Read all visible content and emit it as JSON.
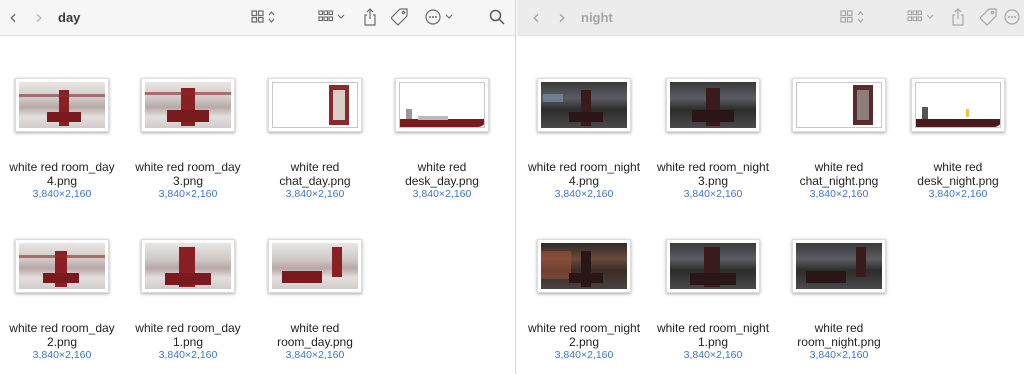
{
  "left_window": {
    "title": "day",
    "items": [
      {
        "name_line1": "white red room_day",
        "name_line2": "4.png",
        "dims": "3,840×2,160"
      },
      {
        "name_line1": "white red room_day",
        "name_line2": "3.png",
        "dims": "3,840×2,160"
      },
      {
        "name_line1": "white red",
        "name_line2": "chat_day.png",
        "dims": "3,840×2,160"
      },
      {
        "name_line1": "white red",
        "name_line2": "desk_day.png",
        "dims": "3,840×2,160"
      },
      {
        "name_line1": "white red room_day",
        "name_line2": "2.png",
        "dims": "3,840×2,160"
      },
      {
        "name_line1": "white red room_day",
        "name_line2": "1.png",
        "dims": "3,840×2,160"
      },
      {
        "name_line1": "white red",
        "name_line2": "room_day.png",
        "dims": "3,840×2,160"
      }
    ]
  },
  "right_window": {
    "title": "night",
    "items": [
      {
        "name_line1": "white red room_night",
        "name_line2": "4.png",
        "dims": "3,840×2,160"
      },
      {
        "name_line1": "white red room_night",
        "name_line2": "3.png",
        "dims": "3,840×2,160"
      },
      {
        "name_line1": "white red",
        "name_line2": "chat_night.png",
        "dims": "3,840×2,160"
      },
      {
        "name_line1": "white red",
        "name_line2": "desk_night.png",
        "dims": "3,840×2,160"
      },
      {
        "name_line1": "white red room_night",
        "name_line2": "2.png",
        "dims": "3,840×2,160"
      },
      {
        "name_line1": "white red room_night",
        "name_line2": "1.png",
        "dims": "3,840×2,160"
      },
      {
        "name_line1": "white red",
        "name_line2": "room_night.png",
        "dims": "3,840×2,160"
      }
    ]
  },
  "toolbar_icons": [
    "back-icon",
    "forward-icon",
    "icon-view-grid-icon",
    "group-by-icon",
    "share-icon",
    "tag-icon",
    "more-actions-icon",
    "search-icon"
  ],
  "colors": {
    "dims_text": "#3d74c8",
    "accent_red": "#8a1f24"
  }
}
